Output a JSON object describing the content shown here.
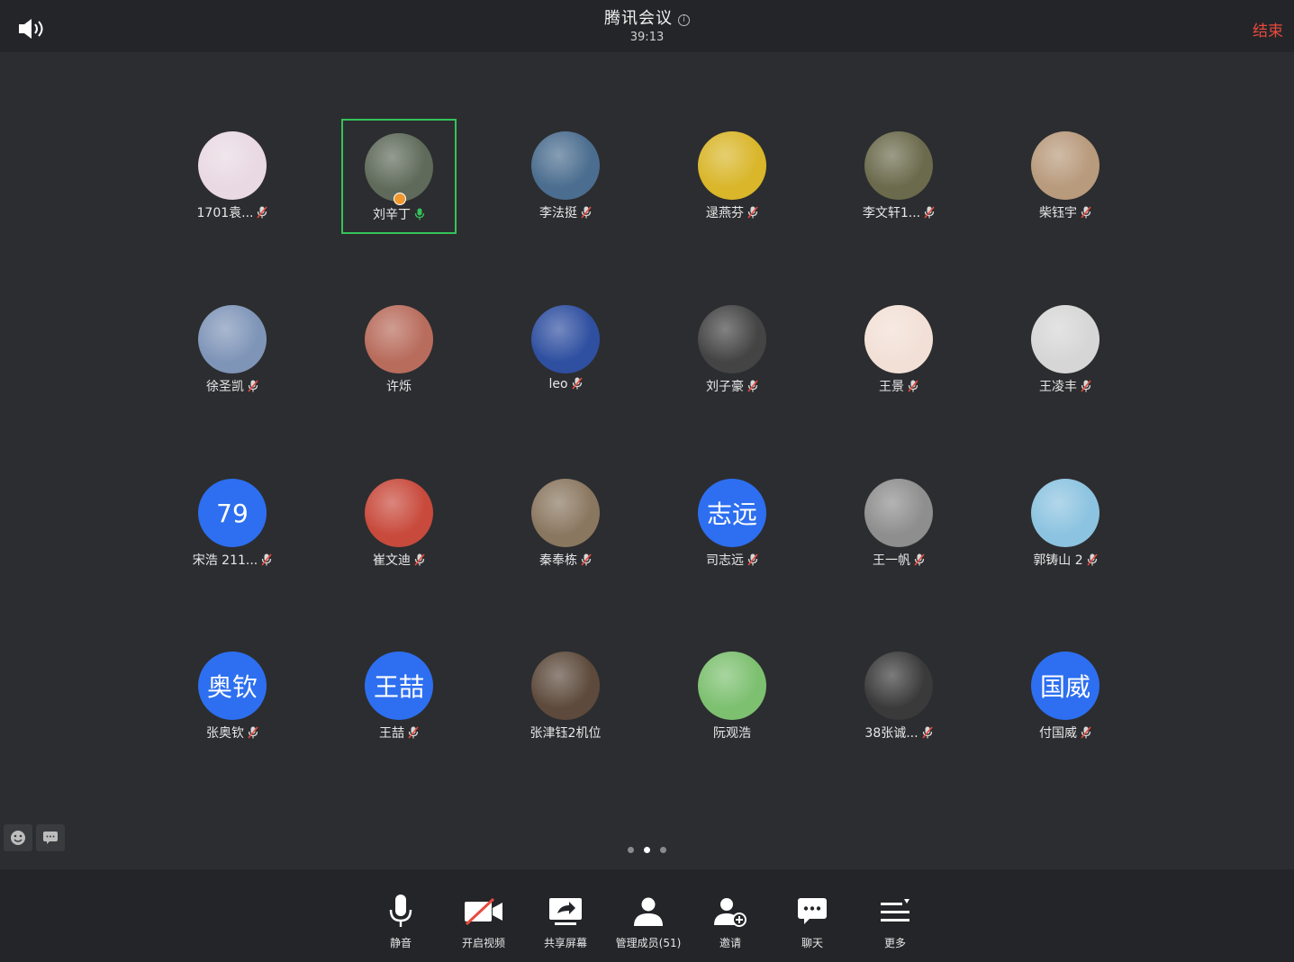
{
  "header": {
    "title": "腾讯会议",
    "info_icon": "i",
    "timer": "39:13",
    "end_label": "结束"
  },
  "participants": [
    {
      "name": "1701袁...",
      "muted": true,
      "avatar_color": "#e9d9e2"
    },
    {
      "name": "刘辛丁",
      "muted": false,
      "speaking": true,
      "host": true,
      "avatar_color": "#5f6a5a"
    },
    {
      "name": "李法挺",
      "muted": true,
      "avatar_color": "#4b6d8f"
    },
    {
      "name": "逯燕芬",
      "muted": true,
      "avatar_color": "#d9b62a"
    },
    {
      "name": "李文轩1...",
      "muted": true,
      "avatar_color": "#6b6a4c"
    },
    {
      "name": "柴钰宇",
      "muted": true,
      "avatar_color": "#b89a7c"
    },
    {
      "name": "徐圣凯",
      "muted": true,
      "avatar_color": "#7f95b8"
    },
    {
      "name": "许烁",
      "muted": false,
      "avatar_color": "#b86c5c"
    },
    {
      "name": "leo",
      "muted": true,
      "avatar_color": "#2f4fa0"
    },
    {
      "name": "刘子豪",
      "muted": true,
      "avatar_color": "#444444"
    },
    {
      "name": "王景",
      "muted": true,
      "avatar_color": "#f2e0d6"
    },
    {
      "name": "王凌丰",
      "muted": true,
      "avatar_color": "#d6d6d6"
    },
    {
      "name": "宋浩 211...",
      "muted": true,
      "avatar_text": "79"
    },
    {
      "name": "崔文迪",
      "muted": true,
      "avatar_color": "#c84a3c"
    },
    {
      "name": "秦奉栋",
      "muted": true,
      "avatar_color": "#8a7760"
    },
    {
      "name": "司志远",
      "muted": true,
      "avatar_text": "志远"
    },
    {
      "name": "王一帆",
      "muted": true,
      "avatar_color": "#8e8e8e"
    },
    {
      "name": "郭铸山 2",
      "muted": true,
      "avatar_color": "#8cc3e0"
    },
    {
      "name": "张奥钦",
      "muted": true,
      "avatar_text": "奥钦"
    },
    {
      "name": "王喆",
      "muted": true,
      "avatar_text": "王喆"
    },
    {
      "name": "张津钰2机位",
      "muted": false,
      "avatar_color": "#5d4a3c"
    },
    {
      "name": "阮观浩",
      "muted": false,
      "avatar_color": "#7dc070"
    },
    {
      "name": "38张诚...",
      "muted": true,
      "avatar_color": "#3a3a3a"
    },
    {
      "name": "付国威",
      "muted": true,
      "avatar_text": "国威"
    }
  ],
  "pager": {
    "pages": 3,
    "current": 2
  },
  "toolbar": {
    "mute": "静音",
    "video": "开启视频",
    "share": "共享屏幕",
    "members": "管理成员(51)",
    "invite": "邀请",
    "chat": "聊天",
    "more": "更多"
  },
  "colors": {
    "background": "#2c2d30",
    "bar": "#242528",
    "accent_blue": "#2d6ff0",
    "speaking_green": "#35c35a",
    "end_red": "#e84a3f"
  }
}
